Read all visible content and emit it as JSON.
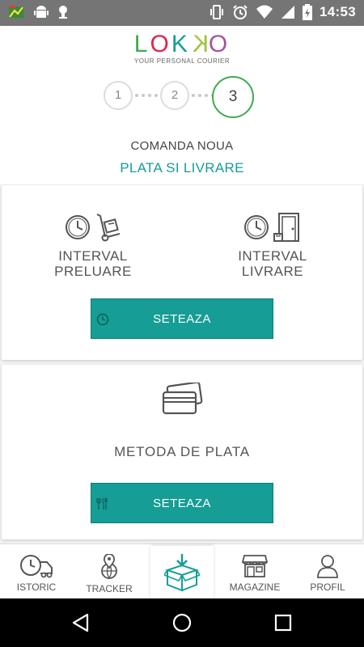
{
  "status_bar": {
    "time": "14:53",
    "icons": [
      "app-icon",
      "android-icon",
      "android-debug-icon",
      "vibrate-icon",
      "alarm-icon",
      "wifi-icon",
      "signal-icon",
      "battery-charging-icon"
    ]
  },
  "brand": {
    "logo_letters": [
      "L",
      "O",
      "K",
      "K",
      "O"
    ],
    "logo_colors": [
      "#3faa4f",
      "#e3234b",
      "#159e96",
      "#a0c33a",
      "#a4559b"
    ],
    "tagline": "YOUR PERSONAL COURIER"
  },
  "stepper": {
    "steps": [
      "1",
      "2",
      "3"
    ],
    "active_step": "3",
    "active_color": "#3faa4f"
  },
  "page": {
    "title": "COMANDA NOUA",
    "subtitle": "PLATA SI LIVRARE",
    "accent_color": "#159e96"
  },
  "interval_card": {
    "pickup_label_line1": "INTERVAL",
    "pickup_label_line2": "PRELUARE",
    "delivery_label_line1": "INTERVAL",
    "delivery_label_line2": "LIVRARE",
    "button_label": "SETEAZA",
    "button_icon": "clock-icon"
  },
  "payment_card": {
    "icon": "credit-card-icon",
    "label": "METODA DE PLATA",
    "button_label": "SETEAZA",
    "button_icon": "cutlery-icon"
  },
  "bottom_nav": {
    "items": [
      {
        "label": "ISTORIC",
        "icon": "delivery-truck-clock-icon"
      },
      {
        "label": "TRACKER",
        "icon": "location-globe-icon"
      },
      {
        "label": "",
        "icon": "add-package-icon"
      },
      {
        "label": "MAGAZINE",
        "icon": "shop-icon"
      },
      {
        "label": "PROFIL",
        "icon": "user-icon"
      }
    ]
  },
  "system_nav": {
    "icons": [
      "back-icon",
      "home-icon",
      "recents-icon"
    ]
  }
}
